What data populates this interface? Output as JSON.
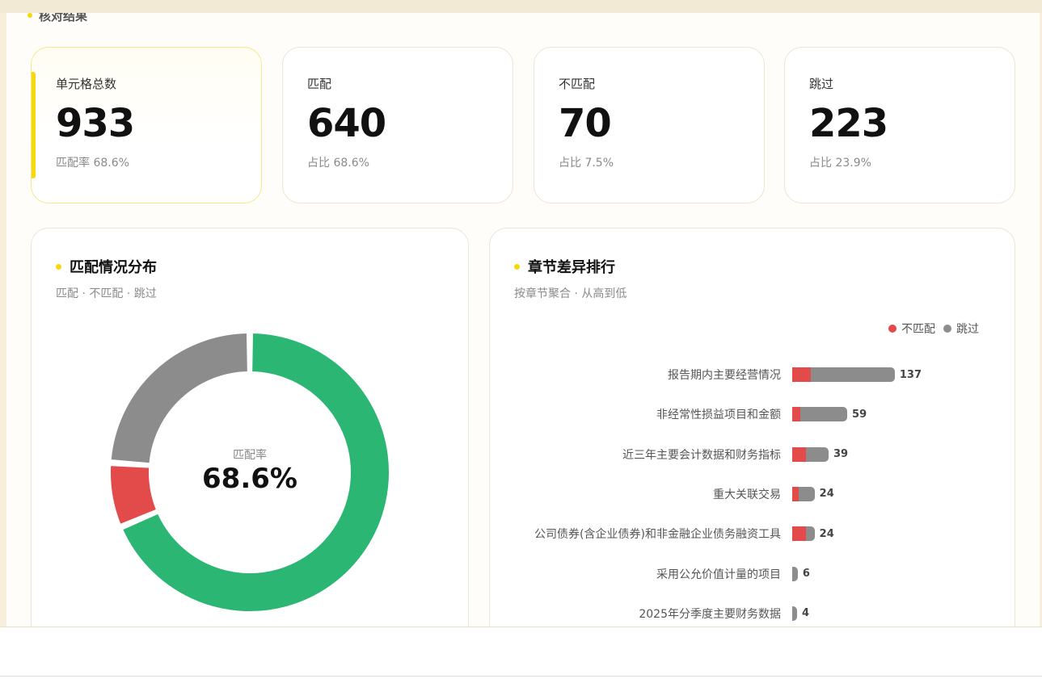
{
  "section": {
    "title": "核对结果"
  },
  "stats": [
    {
      "label": "单元格总数",
      "value": "933",
      "sub": "匹配率 68.6%"
    },
    {
      "label": "匹配",
      "value": "640",
      "sub": "占比 68.6%"
    },
    {
      "label": "不匹配",
      "value": "70",
      "sub": "占比 7.5%"
    },
    {
      "label": "跳过",
      "value": "223",
      "sub": "占比 23.9%"
    }
  ],
  "distribution": {
    "title": "匹配情况分布",
    "subtitle": "匹配 · 不匹配 · 跳过",
    "center_label": "匹配率",
    "center_value": "68.6%"
  },
  "ranking": {
    "title": "章节差异排行",
    "subtitle": "按章节聚合 · 从高到低",
    "legend": {
      "mismatch": "不匹配",
      "skip": "跳过"
    }
  },
  "colors": {
    "match": "#2bb673",
    "mismatch": "#e34a4a",
    "skip": "#8c8c8c",
    "accent": "#f5d90a"
  },
  "chart_data": [
    {
      "type": "pie",
      "title": "匹配情况分布",
      "categories": [
        "匹配",
        "不匹配",
        "跳过"
      ],
      "values": [
        640,
        70,
        223
      ],
      "colors": [
        "#2bb673",
        "#e34a4a",
        "#8c8c8c"
      ],
      "donut": true
    },
    {
      "type": "bar",
      "title": "章节差异排行",
      "orientation": "horizontal",
      "stacked": true,
      "categories": [
        "报告期内主要经营情况",
        "非经常性损益项目和金额",
        "近三年主要会计数据和财务指标",
        "重大关联交易",
        "公司债券(含企业债券)和非金融企业债务融资工具",
        "采用公允价值计量的项目",
        "2025年分季度主要财务数据"
      ],
      "totals": [
        137,
        59,
        39,
        24,
        24,
        6,
        4
      ],
      "series": [
        {
          "name": "不匹配",
          "values": [
            25,
            9,
            15,
            7,
            15,
            0,
            0
          ]
        },
        {
          "name": "跳过",
          "values": [
            112,
            50,
            24,
            17,
            9,
            6,
            4
          ]
        }
      ],
      "legend": "top-right"
    }
  ]
}
